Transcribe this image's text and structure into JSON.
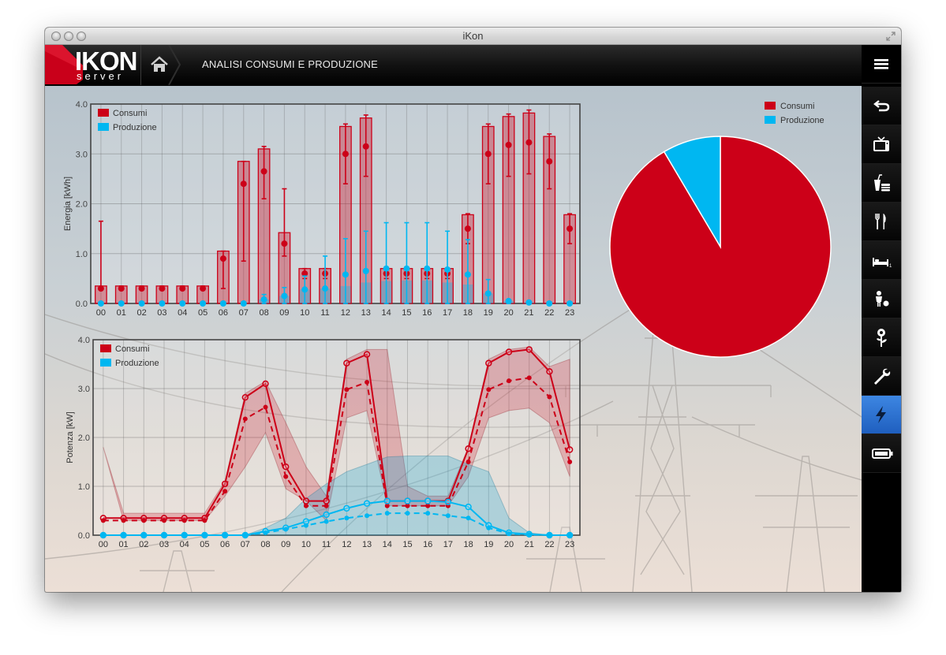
{
  "window": {
    "title": "iKon"
  },
  "header": {
    "logo_main": "IKON",
    "logo_sub": "server",
    "title": "ANALISI CONSUMI E PRODUZIONE"
  },
  "sidebar": {
    "items": [
      {
        "icon": "menu-icon"
      },
      {
        "icon": "back-icon"
      },
      {
        "icon": "tv-icon"
      },
      {
        "icon": "appliances-icon"
      },
      {
        "icon": "kitchen-icon"
      },
      {
        "icon": "bedroom-icon"
      },
      {
        "icon": "kids-icon"
      },
      {
        "icon": "garden-icon"
      },
      {
        "icon": "wrench-icon"
      },
      {
        "icon": "energy-icon",
        "active": true
      },
      {
        "icon": "battery-icon"
      }
    ]
  },
  "colors": {
    "consumi": "#cc0018",
    "produzione": "#00b7f1",
    "active": "#2a6fd1"
  },
  "chart_data": [
    {
      "type": "bar",
      "ylabel": "Energia [kWh]",
      "ylim": [
        0,
        4
      ],
      "yticks": [
        "0.0",
        "1.0",
        "2.0",
        "3.0",
        "4.0"
      ],
      "categories": [
        "00",
        "01",
        "02",
        "03",
        "04",
        "05",
        "06",
        "07",
        "08",
        "09",
        "10",
        "11",
        "12",
        "13",
        "14",
        "15",
        "16",
        "17",
        "18",
        "19",
        "20",
        "21",
        "22",
        "23"
      ],
      "legend": {
        "placement": "top-left"
      },
      "series": [
        {
          "name": "Consumi",
          "values": [
            0.35,
            0.35,
            0.35,
            0.35,
            0.35,
            0.35,
            1.05,
            2.85,
            3.1,
            1.42,
            0.7,
            0.7,
            3.55,
            3.72,
            0.7,
            0.7,
            0.7,
            0.7,
            1.78,
            3.55,
            3.75,
            3.82,
            3.35,
            1.78
          ],
          "mean": [
            0.3,
            0.3,
            0.3,
            0.3,
            0.3,
            0.3,
            0.9,
            2.4,
            2.65,
            1.2,
            0.6,
            0.6,
            3.0,
            3.15,
            0.6,
            0.6,
            0.6,
            0.6,
            1.5,
            3.0,
            3.18,
            3.23,
            2.85,
            1.5
          ],
          "err_low": [
            0.28,
            0.28,
            0.28,
            0.28,
            0.28,
            0.28,
            0.3,
            0.85,
            2.1,
            0.95,
            0.5,
            0.5,
            2.4,
            2.55,
            0.5,
            0.5,
            0.5,
            0.5,
            1.2,
            2.4,
            2.55,
            2.6,
            2.3,
            1.2
          ],
          "err_high": [
            1.65,
            0.35,
            0.35,
            0.35,
            0.35,
            0.35,
            1.05,
            2.85,
            3.15,
            2.3,
            0.7,
            0.7,
            3.6,
            3.78,
            0.7,
            0.7,
            0.7,
            0.7,
            1.8,
            3.6,
            3.8,
            3.88,
            3.4,
            1.8
          ]
        },
        {
          "name": "Produzione",
          "values": [
            0,
            0,
            0,
            0,
            0,
            0,
            0,
            0,
            0.08,
            0.15,
            0.28,
            0.3,
            0.35,
            0.42,
            0.45,
            0.46,
            0.46,
            0.42,
            0.38,
            0.2,
            0.05,
            0.02,
            0,
            0
          ],
          "mean": [
            0,
            0,
            0,
            0,
            0,
            0,
            0,
            0,
            0.08,
            0.15,
            0.28,
            0.3,
            0.58,
            0.65,
            0.7,
            0.7,
            0.7,
            0.68,
            0.58,
            0.2,
            0.05,
            0.02,
            0,
            0
          ],
          "err_low": [
            0,
            0,
            0,
            0,
            0,
            0,
            0,
            0,
            0,
            0,
            0,
            0,
            0,
            0,
            0,
            0,
            0,
            0,
            0,
            0,
            0,
            0,
            0,
            0
          ],
          "err_high": [
            0,
            0,
            0,
            0,
            0,
            0,
            0,
            0,
            0.18,
            0.32,
            0.55,
            0.95,
            1.3,
            1.45,
            1.62,
            1.62,
            1.62,
            1.45,
            1.28,
            0.48,
            0.05,
            0.02,
            0,
            0
          ]
        }
      ]
    },
    {
      "type": "line",
      "ylabel": "Potenza [kW]",
      "ylim": [
        0,
        4
      ],
      "yticks": [
        "0.0",
        "1.0",
        "2.0",
        "3.0",
        "4.0"
      ],
      "categories": [
        "00",
        "01",
        "02",
        "03",
        "04",
        "05",
        "06",
        "07",
        "08",
        "09",
        "10",
        "11",
        "12",
        "13",
        "14",
        "15",
        "16",
        "17",
        "18",
        "19",
        "20",
        "21",
        "22",
        "23"
      ],
      "legend": {
        "placement": "top-left"
      },
      "series": [
        {
          "name": "Consumi",
          "max": [
            0.35,
            0.35,
            0.35,
            0.35,
            0.35,
            0.35,
            1.05,
            2.82,
            3.1,
            1.4,
            0.7,
            0.7,
            3.52,
            3.7,
            0.7,
            0.7,
            0.7,
            0.7,
            1.77,
            3.52,
            3.75,
            3.8,
            3.35,
            1.75
          ],
          "mean": [
            0.3,
            0.3,
            0.3,
            0.3,
            0.3,
            0.3,
            0.9,
            2.38,
            2.62,
            1.2,
            0.6,
            0.6,
            2.98,
            3.13,
            0.6,
            0.6,
            0.6,
            0.6,
            1.5,
            2.98,
            3.16,
            3.22,
            2.83,
            1.5
          ],
          "band_low": [
            1.8,
            0.3,
            0.3,
            0.3,
            0.3,
            0.3,
            0.8,
            1.4,
            2.1,
            0.95,
            0.7,
            0.3,
            2.4,
            2.55,
            0.6,
            0.6,
            0.6,
            0.6,
            1.2,
            2.4,
            2.55,
            2.6,
            2.3,
            1.2
          ],
          "band_high": [
            1.8,
            0.45,
            0.45,
            0.45,
            0.45,
            0.45,
            1.1,
            2.9,
            3.15,
            2.3,
            1.4,
            0.8,
            3.6,
            3.8,
            3.8,
            1.0,
            0.8,
            0.8,
            1.8,
            3.6,
            3.8,
            3.85,
            3.45,
            3.6
          ]
        },
        {
          "name": "Produzione",
          "max": [
            0,
            0,
            0,
            0,
            0,
            0,
            0,
            0,
            0.08,
            0.15,
            0.28,
            0.42,
            0.55,
            0.65,
            0.7,
            0.7,
            0.7,
            0.68,
            0.58,
            0.2,
            0.05,
            0.02,
            0,
            0
          ],
          "mean": [
            0,
            0,
            0,
            0,
            0,
            0,
            0,
            0,
            0.05,
            0.12,
            0.2,
            0.28,
            0.35,
            0.4,
            0.45,
            0.45,
            0.45,
            0.4,
            0.35,
            0.15,
            0.03,
            0.01,
            0,
            0
          ],
          "band_low": [
            0,
            0,
            0,
            0,
            0,
            0,
            0,
            0,
            0,
            0,
            0,
            0,
            0,
            0,
            0,
            0,
            0,
            0,
            0,
            0,
            0,
            0,
            0,
            0
          ],
          "band_high": [
            0,
            0,
            0,
            0,
            0,
            0,
            0,
            0,
            0.15,
            0.35,
            0.75,
            1.05,
            1.3,
            1.45,
            1.6,
            1.62,
            1.62,
            1.62,
            1.45,
            1.3,
            0.35,
            0.05,
            0,
            0
          ]
        }
      ]
    },
    {
      "type": "pie",
      "legend": {
        "placement": "top-right"
      },
      "labels": [
        "Consumi",
        "Produzione"
      ],
      "values": [
        91.5,
        8.5
      ]
    }
  ]
}
